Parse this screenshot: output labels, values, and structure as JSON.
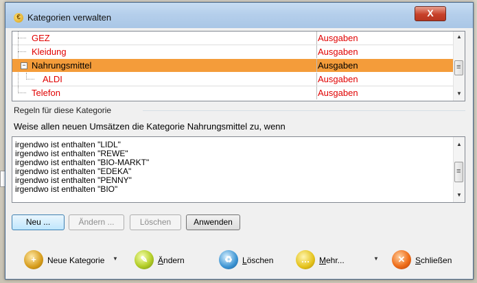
{
  "window": {
    "title": "Kategorien verwalten",
    "close_glyph": "X"
  },
  "categories": [
    {
      "name": "GEZ",
      "type": "Ausgaben",
      "selected": false
    },
    {
      "name": "Kleidung",
      "type": "Ausgaben",
      "selected": false
    },
    {
      "name": "Nahrungsmittel",
      "type": "Ausgaben",
      "selected": true,
      "expanded": true
    },
    {
      "name": "ALDI",
      "type": "Ausgaben",
      "selected": false,
      "child": true
    },
    {
      "name": "Telefon",
      "type": "Ausgaben",
      "selected": false
    }
  ],
  "rules_section": {
    "label": "Regeln für diese Kategorie",
    "prompt": "Weise allen neuen Umsätzen die Kategorie Nahrungsmittel zu, wenn",
    "rules": [
      "irgendwo ist enthalten \"LIDL\"",
      "irgendwo ist enthalten \"REWE\"",
      "irgendwo ist enthalten \"BIO-MARKT\"",
      "irgendwo ist enthalten \"EDEKA\"",
      "irgendwo ist enthalten \"PENNY\"",
      "irgendwo ist enthalten \"BIO\""
    ]
  },
  "rule_buttons": {
    "new": "Neu ...",
    "edit": "Ändern ...",
    "delete": "Löschen",
    "apply": "Anwenden"
  },
  "toolbar": {
    "new_category": "Neue Kategorie",
    "edit_first": "Ä",
    "edit_rest": "ndern",
    "delete_first": "L",
    "delete_rest": "öschen",
    "more_first": "M",
    "more_rest": "ehr...",
    "close_first": "S",
    "close_rest": "chließen"
  },
  "icons": {
    "new_category": "folder-plus-icon",
    "edit": "pencil-icon",
    "delete": "recycle-bin-icon",
    "more": "speech-bubble-icon",
    "close": "red-x-icon"
  }
}
